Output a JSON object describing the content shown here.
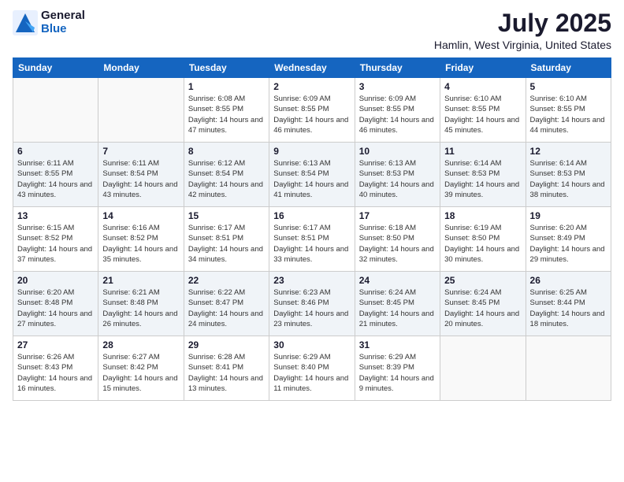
{
  "logo": {
    "general": "General",
    "blue": "Blue"
  },
  "title": "July 2025",
  "subtitle": "Hamlin, West Virginia, United States",
  "days_of_week": [
    "Sunday",
    "Monday",
    "Tuesday",
    "Wednesday",
    "Thursday",
    "Friday",
    "Saturday"
  ],
  "weeks": [
    [
      {
        "day": "",
        "sunrise": "",
        "sunset": "",
        "daylight": ""
      },
      {
        "day": "",
        "sunrise": "",
        "sunset": "",
        "daylight": ""
      },
      {
        "day": "1",
        "sunrise": "Sunrise: 6:08 AM",
        "sunset": "Sunset: 8:55 PM",
        "daylight": "Daylight: 14 hours and 47 minutes."
      },
      {
        "day": "2",
        "sunrise": "Sunrise: 6:09 AM",
        "sunset": "Sunset: 8:55 PM",
        "daylight": "Daylight: 14 hours and 46 minutes."
      },
      {
        "day": "3",
        "sunrise": "Sunrise: 6:09 AM",
        "sunset": "Sunset: 8:55 PM",
        "daylight": "Daylight: 14 hours and 46 minutes."
      },
      {
        "day": "4",
        "sunrise": "Sunrise: 6:10 AM",
        "sunset": "Sunset: 8:55 PM",
        "daylight": "Daylight: 14 hours and 45 minutes."
      },
      {
        "day": "5",
        "sunrise": "Sunrise: 6:10 AM",
        "sunset": "Sunset: 8:55 PM",
        "daylight": "Daylight: 14 hours and 44 minutes."
      }
    ],
    [
      {
        "day": "6",
        "sunrise": "Sunrise: 6:11 AM",
        "sunset": "Sunset: 8:55 PM",
        "daylight": "Daylight: 14 hours and 43 minutes."
      },
      {
        "day": "7",
        "sunrise": "Sunrise: 6:11 AM",
        "sunset": "Sunset: 8:54 PM",
        "daylight": "Daylight: 14 hours and 43 minutes."
      },
      {
        "day": "8",
        "sunrise": "Sunrise: 6:12 AM",
        "sunset": "Sunset: 8:54 PM",
        "daylight": "Daylight: 14 hours and 42 minutes."
      },
      {
        "day": "9",
        "sunrise": "Sunrise: 6:13 AM",
        "sunset": "Sunset: 8:54 PM",
        "daylight": "Daylight: 14 hours and 41 minutes."
      },
      {
        "day": "10",
        "sunrise": "Sunrise: 6:13 AM",
        "sunset": "Sunset: 8:53 PM",
        "daylight": "Daylight: 14 hours and 40 minutes."
      },
      {
        "day": "11",
        "sunrise": "Sunrise: 6:14 AM",
        "sunset": "Sunset: 8:53 PM",
        "daylight": "Daylight: 14 hours and 39 minutes."
      },
      {
        "day": "12",
        "sunrise": "Sunrise: 6:14 AM",
        "sunset": "Sunset: 8:53 PM",
        "daylight": "Daylight: 14 hours and 38 minutes."
      }
    ],
    [
      {
        "day": "13",
        "sunrise": "Sunrise: 6:15 AM",
        "sunset": "Sunset: 8:52 PM",
        "daylight": "Daylight: 14 hours and 37 minutes."
      },
      {
        "day": "14",
        "sunrise": "Sunrise: 6:16 AM",
        "sunset": "Sunset: 8:52 PM",
        "daylight": "Daylight: 14 hours and 35 minutes."
      },
      {
        "day": "15",
        "sunrise": "Sunrise: 6:17 AM",
        "sunset": "Sunset: 8:51 PM",
        "daylight": "Daylight: 14 hours and 34 minutes."
      },
      {
        "day": "16",
        "sunrise": "Sunrise: 6:17 AM",
        "sunset": "Sunset: 8:51 PM",
        "daylight": "Daylight: 14 hours and 33 minutes."
      },
      {
        "day": "17",
        "sunrise": "Sunrise: 6:18 AM",
        "sunset": "Sunset: 8:50 PM",
        "daylight": "Daylight: 14 hours and 32 minutes."
      },
      {
        "day": "18",
        "sunrise": "Sunrise: 6:19 AM",
        "sunset": "Sunset: 8:50 PM",
        "daylight": "Daylight: 14 hours and 30 minutes."
      },
      {
        "day": "19",
        "sunrise": "Sunrise: 6:20 AM",
        "sunset": "Sunset: 8:49 PM",
        "daylight": "Daylight: 14 hours and 29 minutes."
      }
    ],
    [
      {
        "day": "20",
        "sunrise": "Sunrise: 6:20 AM",
        "sunset": "Sunset: 8:48 PM",
        "daylight": "Daylight: 14 hours and 27 minutes."
      },
      {
        "day": "21",
        "sunrise": "Sunrise: 6:21 AM",
        "sunset": "Sunset: 8:48 PM",
        "daylight": "Daylight: 14 hours and 26 minutes."
      },
      {
        "day": "22",
        "sunrise": "Sunrise: 6:22 AM",
        "sunset": "Sunset: 8:47 PM",
        "daylight": "Daylight: 14 hours and 24 minutes."
      },
      {
        "day": "23",
        "sunrise": "Sunrise: 6:23 AM",
        "sunset": "Sunset: 8:46 PM",
        "daylight": "Daylight: 14 hours and 23 minutes."
      },
      {
        "day": "24",
        "sunrise": "Sunrise: 6:24 AM",
        "sunset": "Sunset: 8:45 PM",
        "daylight": "Daylight: 14 hours and 21 minutes."
      },
      {
        "day": "25",
        "sunrise": "Sunrise: 6:24 AM",
        "sunset": "Sunset: 8:45 PM",
        "daylight": "Daylight: 14 hours and 20 minutes."
      },
      {
        "day": "26",
        "sunrise": "Sunrise: 6:25 AM",
        "sunset": "Sunset: 8:44 PM",
        "daylight": "Daylight: 14 hours and 18 minutes."
      }
    ],
    [
      {
        "day": "27",
        "sunrise": "Sunrise: 6:26 AM",
        "sunset": "Sunset: 8:43 PM",
        "daylight": "Daylight: 14 hours and 16 minutes."
      },
      {
        "day": "28",
        "sunrise": "Sunrise: 6:27 AM",
        "sunset": "Sunset: 8:42 PM",
        "daylight": "Daylight: 14 hours and 15 minutes."
      },
      {
        "day": "29",
        "sunrise": "Sunrise: 6:28 AM",
        "sunset": "Sunset: 8:41 PM",
        "daylight": "Daylight: 14 hours and 13 minutes."
      },
      {
        "day": "30",
        "sunrise": "Sunrise: 6:29 AM",
        "sunset": "Sunset: 8:40 PM",
        "daylight": "Daylight: 14 hours and 11 minutes."
      },
      {
        "day": "31",
        "sunrise": "Sunrise: 6:29 AM",
        "sunset": "Sunset: 8:39 PM",
        "daylight": "Daylight: 14 hours and 9 minutes."
      },
      {
        "day": "",
        "sunrise": "",
        "sunset": "",
        "daylight": ""
      },
      {
        "day": "",
        "sunrise": "",
        "sunset": "",
        "daylight": ""
      }
    ]
  ]
}
